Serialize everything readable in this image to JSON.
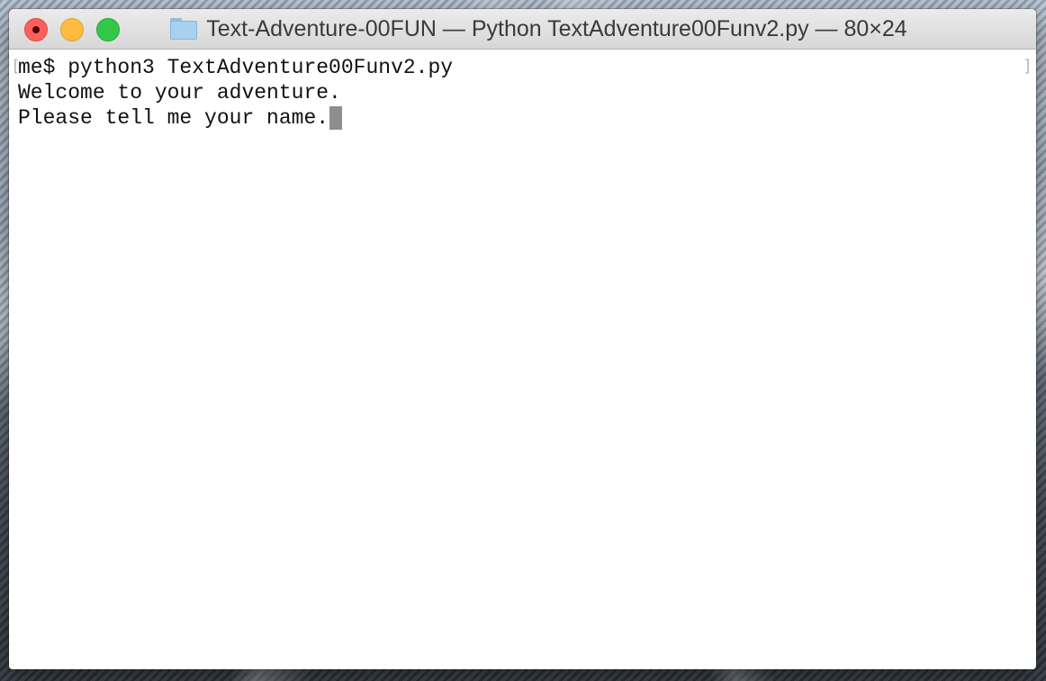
{
  "window": {
    "title": "Text-Adventure-00FUN — Python TextAdventure00Funv2.py — 80×24",
    "folder_icon": "folder-icon",
    "controls": {
      "close": "close-button",
      "minimize": "minimize-button",
      "zoom": "zoom-button",
      "colors": {
        "close": "#fc605c",
        "minimize": "#fdbc40",
        "zoom": "#34c84a"
      }
    }
  },
  "terminal": {
    "lines": [
      "me$ python3 TextAdventure00Funv2.py",
      "Welcome to your adventure.",
      "Please tell me your name."
    ],
    "mark_left": "[",
    "mark_right": "]",
    "cursor_color": "#8e8e8e"
  }
}
